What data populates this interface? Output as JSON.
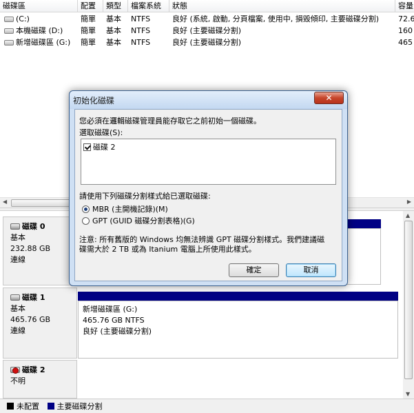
{
  "volume_list": {
    "columns": [
      "磁碟區",
      "配置",
      "類型",
      "檔案系統",
      "狀態",
      "容量"
    ],
    "rows": [
      {
        "volume": "(C:)",
        "layout": "簡單",
        "type": "基本",
        "fs": "NTFS",
        "status": "良好 (系統, 啟動, 分頁檔案, 使用中, 損毀傾印, 主要磁碟分割)",
        "capacity": "72.6"
      },
      {
        "volume": "本機磁碟 (D:)",
        "layout": "簡單",
        "type": "基本",
        "fs": "NTFS",
        "status": "良好 (主要磁碟分割)",
        "capacity": "160"
      },
      {
        "volume": "新增磁碟區 (G:)",
        "layout": "簡單",
        "type": "基本",
        "fs": "NTFS",
        "status": "良好 (主要磁碟分割)",
        "capacity": "465"
      }
    ]
  },
  "disks": [
    {
      "name": "磁碟 0",
      "kind": "基本",
      "size": "232.88 GB",
      "state": "連線",
      "icon": "disk-icon"
    },
    {
      "name": "磁碟 1",
      "kind": "基本",
      "size": "465.76 GB",
      "state": "連線",
      "icon": "disk-icon",
      "partition": {
        "name": "新增磁碟區 (G:)",
        "size": "465.76 GB NTFS",
        "status": "良好 (主要磁碟分割)"
      }
    },
    {
      "name": "磁碟 2",
      "kind": "不明",
      "icon": "disk-error-icon"
    }
  ],
  "legend": [
    {
      "label": "未配置",
      "color": "#000000"
    },
    {
      "label": "主要磁碟分割",
      "color": "#000084"
    }
  ],
  "dialog": {
    "title": "初始化磁碟",
    "close_symbol": "✕",
    "intro": "您必須在邏輯磁碟管理員能存取它之前初始一個磁碟。",
    "select_label": "選取磁碟(S):",
    "disks": [
      {
        "label": "磁碟 2",
        "checked": true
      }
    ],
    "style_label": "請使用下列磁碟分割樣式給已選取磁碟:",
    "options": [
      {
        "label": "MBR (主開機記錄)(M)",
        "selected": true
      },
      {
        "label": "GPT (GUID 磁碟分割表格)(G)",
        "selected": false
      }
    ],
    "note_line1": "注意: 所有舊版的 Windows 均無法辨識 GPT 磁碟分割樣式。我們建議磁",
    "note_line2": "碟需大於 2 TB 或為 Itanium 電腦上所使用此樣式。",
    "ok": "確定",
    "cancel": "取消"
  },
  "colors": {
    "primary_partition": "#000084",
    "dialog_frame": "#cfe0f4",
    "close_button": "#c7452b"
  }
}
